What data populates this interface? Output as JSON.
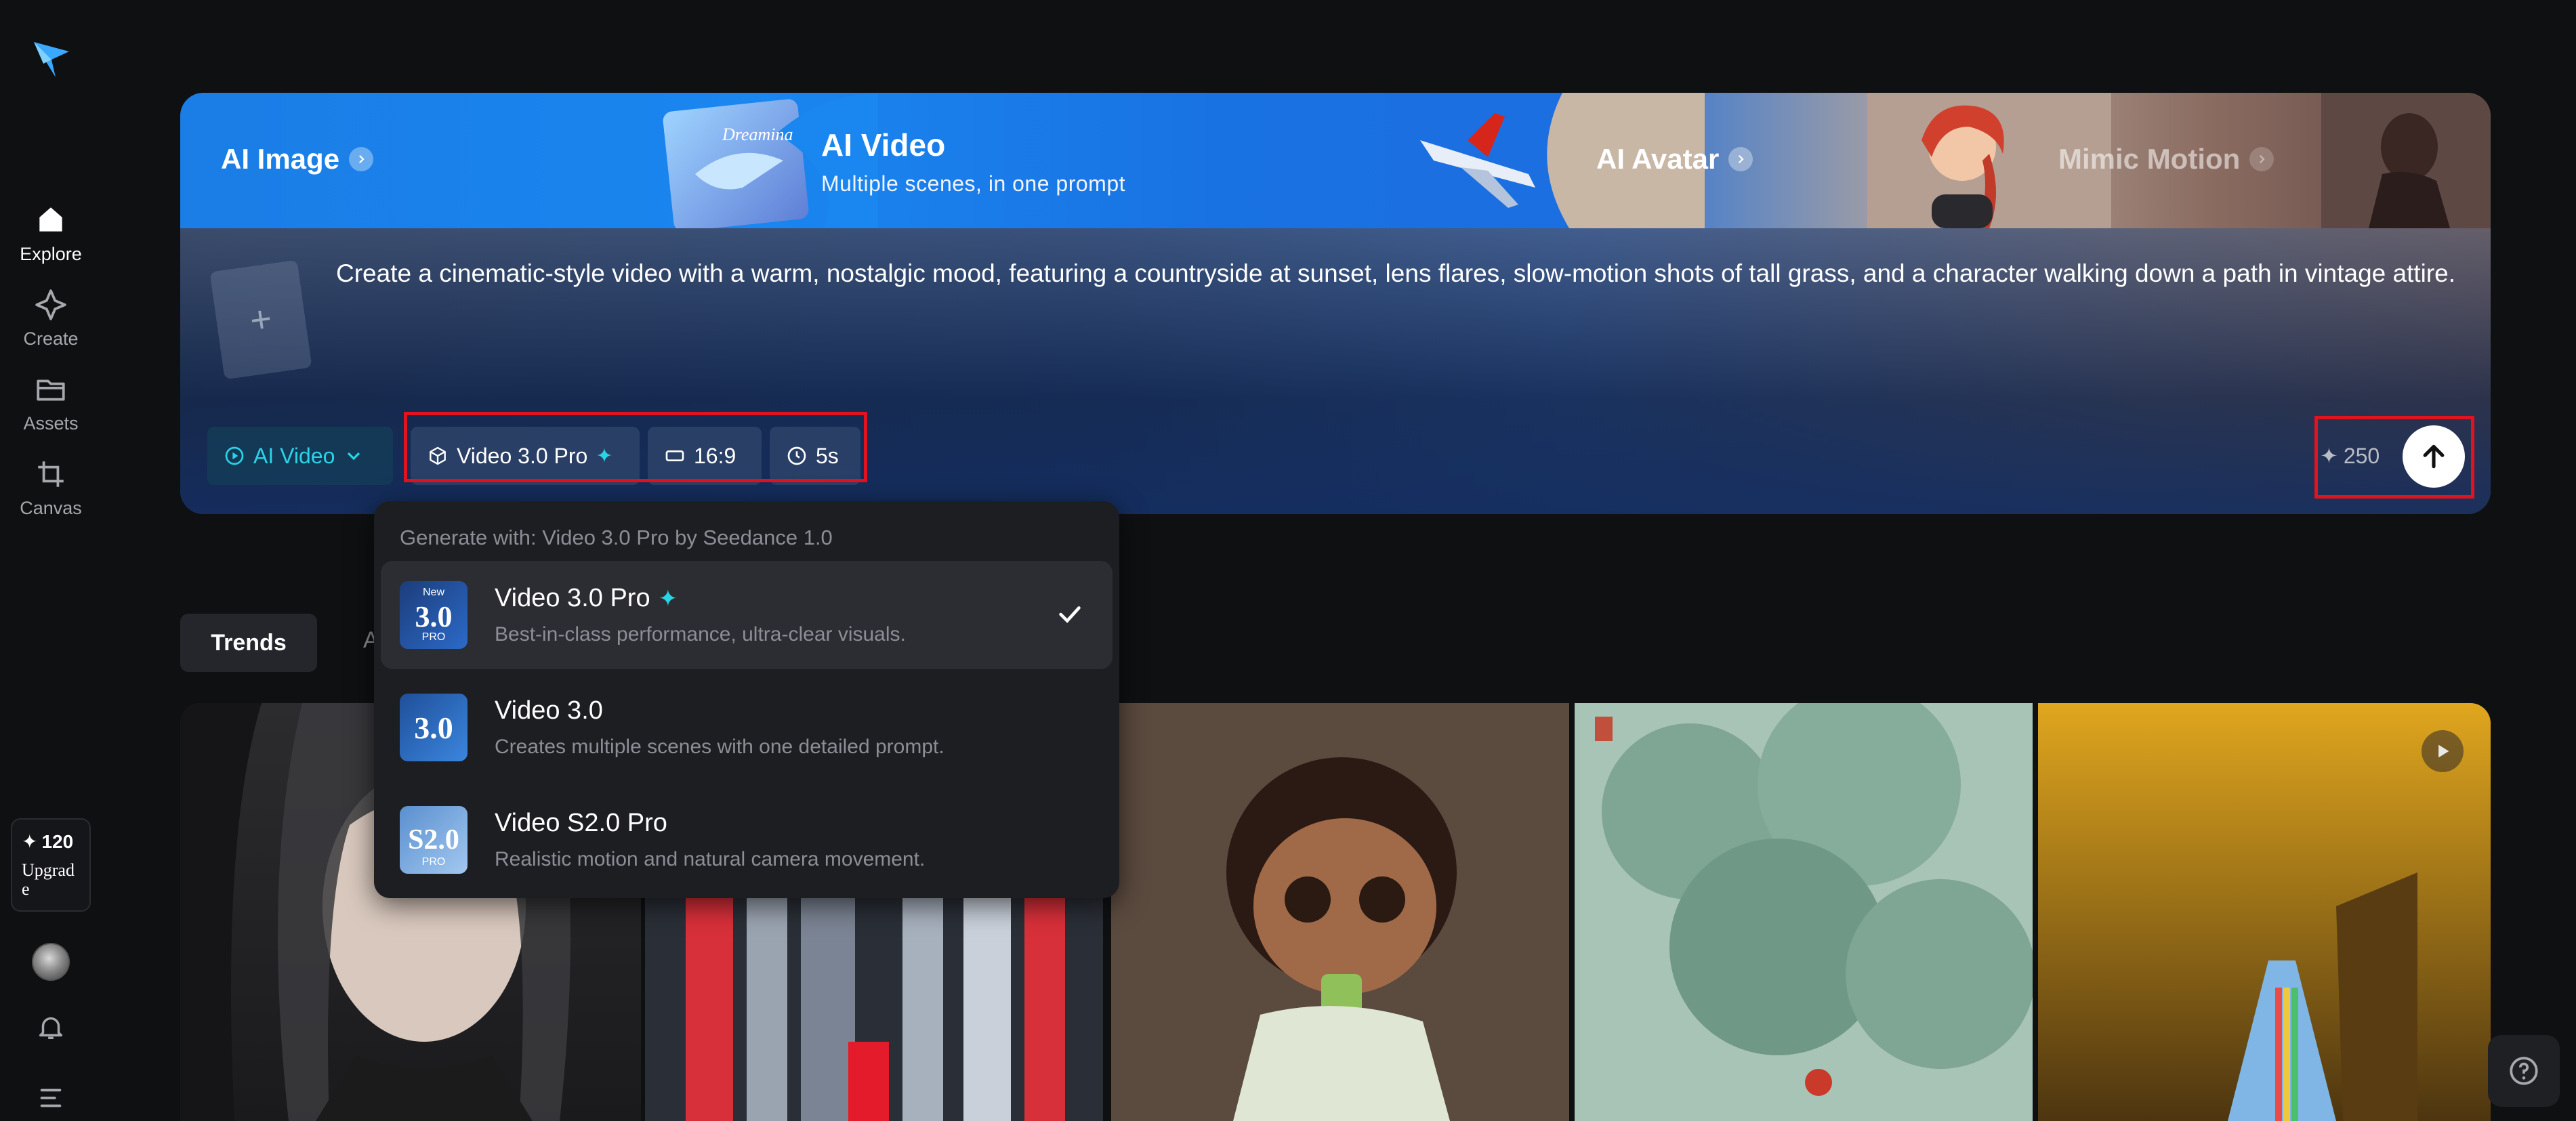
{
  "sidebar": {
    "nav": [
      {
        "label": "Explore",
        "icon": "home-icon",
        "active": true
      },
      {
        "label": "Create",
        "icon": "sparkle-diamond-icon",
        "active": false
      },
      {
        "label": "Assets",
        "icon": "folder-icon",
        "active": false
      },
      {
        "label": "Canvas",
        "icon": "crop-icon",
        "active": false
      }
    ],
    "upgrade": {
      "credits": "120",
      "label": "Upgrade"
    }
  },
  "banner": {
    "tabs": [
      {
        "label": "AI Image"
      },
      {
        "label": "AI Video",
        "subtitle": "Multiple scenes, in one prompt",
        "active": true
      },
      {
        "label": "AI Avatar"
      },
      {
        "label": "Mimic Motion"
      }
    ],
    "whale_caption": "Dreamina"
  },
  "prompt": {
    "text": "Create a cinematic-style video with a warm, nostalgic mood, featuring a countryside at sunset, lens flares, slow-motion shots of tall grass, and a character walking down a path in vintage attire."
  },
  "controls": {
    "mode": "AI Video",
    "model": "Video 3.0 Pro",
    "ratio": "16:9",
    "duration": "5s",
    "cost": "250"
  },
  "dropdown": {
    "header": "Generate with: Video 3.0 Pro by Seedance 1.0",
    "items": [
      {
        "name": "Video 3.0 Pro",
        "desc": "Best-in-class performance, ultra-clear visuals.",
        "badge": "New",
        "thumb_text": "3.0",
        "thumb_sub": "PRO",
        "selected": true
      },
      {
        "name": "Video 3.0",
        "desc": "Creates multiple scenes with one detailed prompt.",
        "thumb_text": "3.0",
        "selected": false
      },
      {
        "name": "Video S2.0 Pro",
        "desc": "Realistic motion and natural camera movement.",
        "thumb_text": "S2.0",
        "thumb_sub": "PRO",
        "selected": false
      }
    ]
  },
  "feed": {
    "tabs": [
      {
        "label": "Trends",
        "active": true
      },
      {
        "label": "A",
        "active": false
      }
    ]
  },
  "colors": {
    "accent": "#2ad3e6",
    "highlight": "#e0131f",
    "banner_blue": "#1a7de6"
  }
}
